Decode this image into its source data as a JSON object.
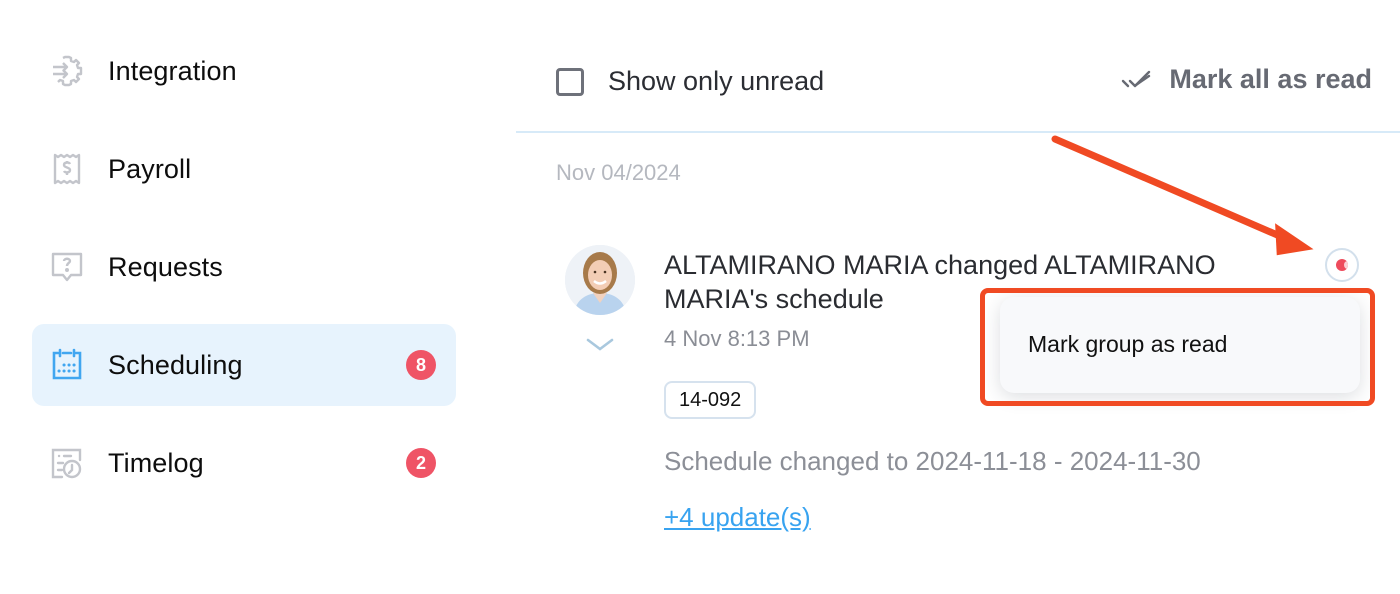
{
  "sidebar": {
    "items": [
      {
        "label": "Integration",
        "icon": "integration-gear-arrows-icon",
        "active": false,
        "badge": null
      },
      {
        "label": "Payroll",
        "icon": "payroll-receipt-dollar-icon",
        "active": false,
        "badge": null
      },
      {
        "label": "Requests",
        "icon": "requests-question-bubble-icon",
        "active": false,
        "badge": null
      },
      {
        "label": "Scheduling",
        "icon": "calendar-icon",
        "active": true,
        "badge": "8"
      },
      {
        "label": "Timelog",
        "icon": "timelog-clock-icon",
        "active": false,
        "badge": "2"
      }
    ]
  },
  "header": {
    "show_unread_label": "Show only unread",
    "show_unread_checked": false,
    "mark_all_label": "Mark all as read"
  },
  "notifications": {
    "date_group": "Nov 04/2024",
    "items": [
      {
        "title": "ALTAMIRANO MARIA changed ALTAMIRANO MARIA's schedule",
        "time": "4 Nov 8:13 PM",
        "tag": "14-092",
        "body": "Schedule changed to 2024-11-18 - 2024-11-30",
        "updates_link": "+4 update(s)",
        "unread": true
      }
    ]
  },
  "popup_menu": {
    "items": [
      "Mark group as read"
    ]
  },
  "colors": {
    "accent": "#38a3f0",
    "badge": "#ef5466",
    "annotation": "#f04a23",
    "active_bg": "#e7f3fd"
  }
}
